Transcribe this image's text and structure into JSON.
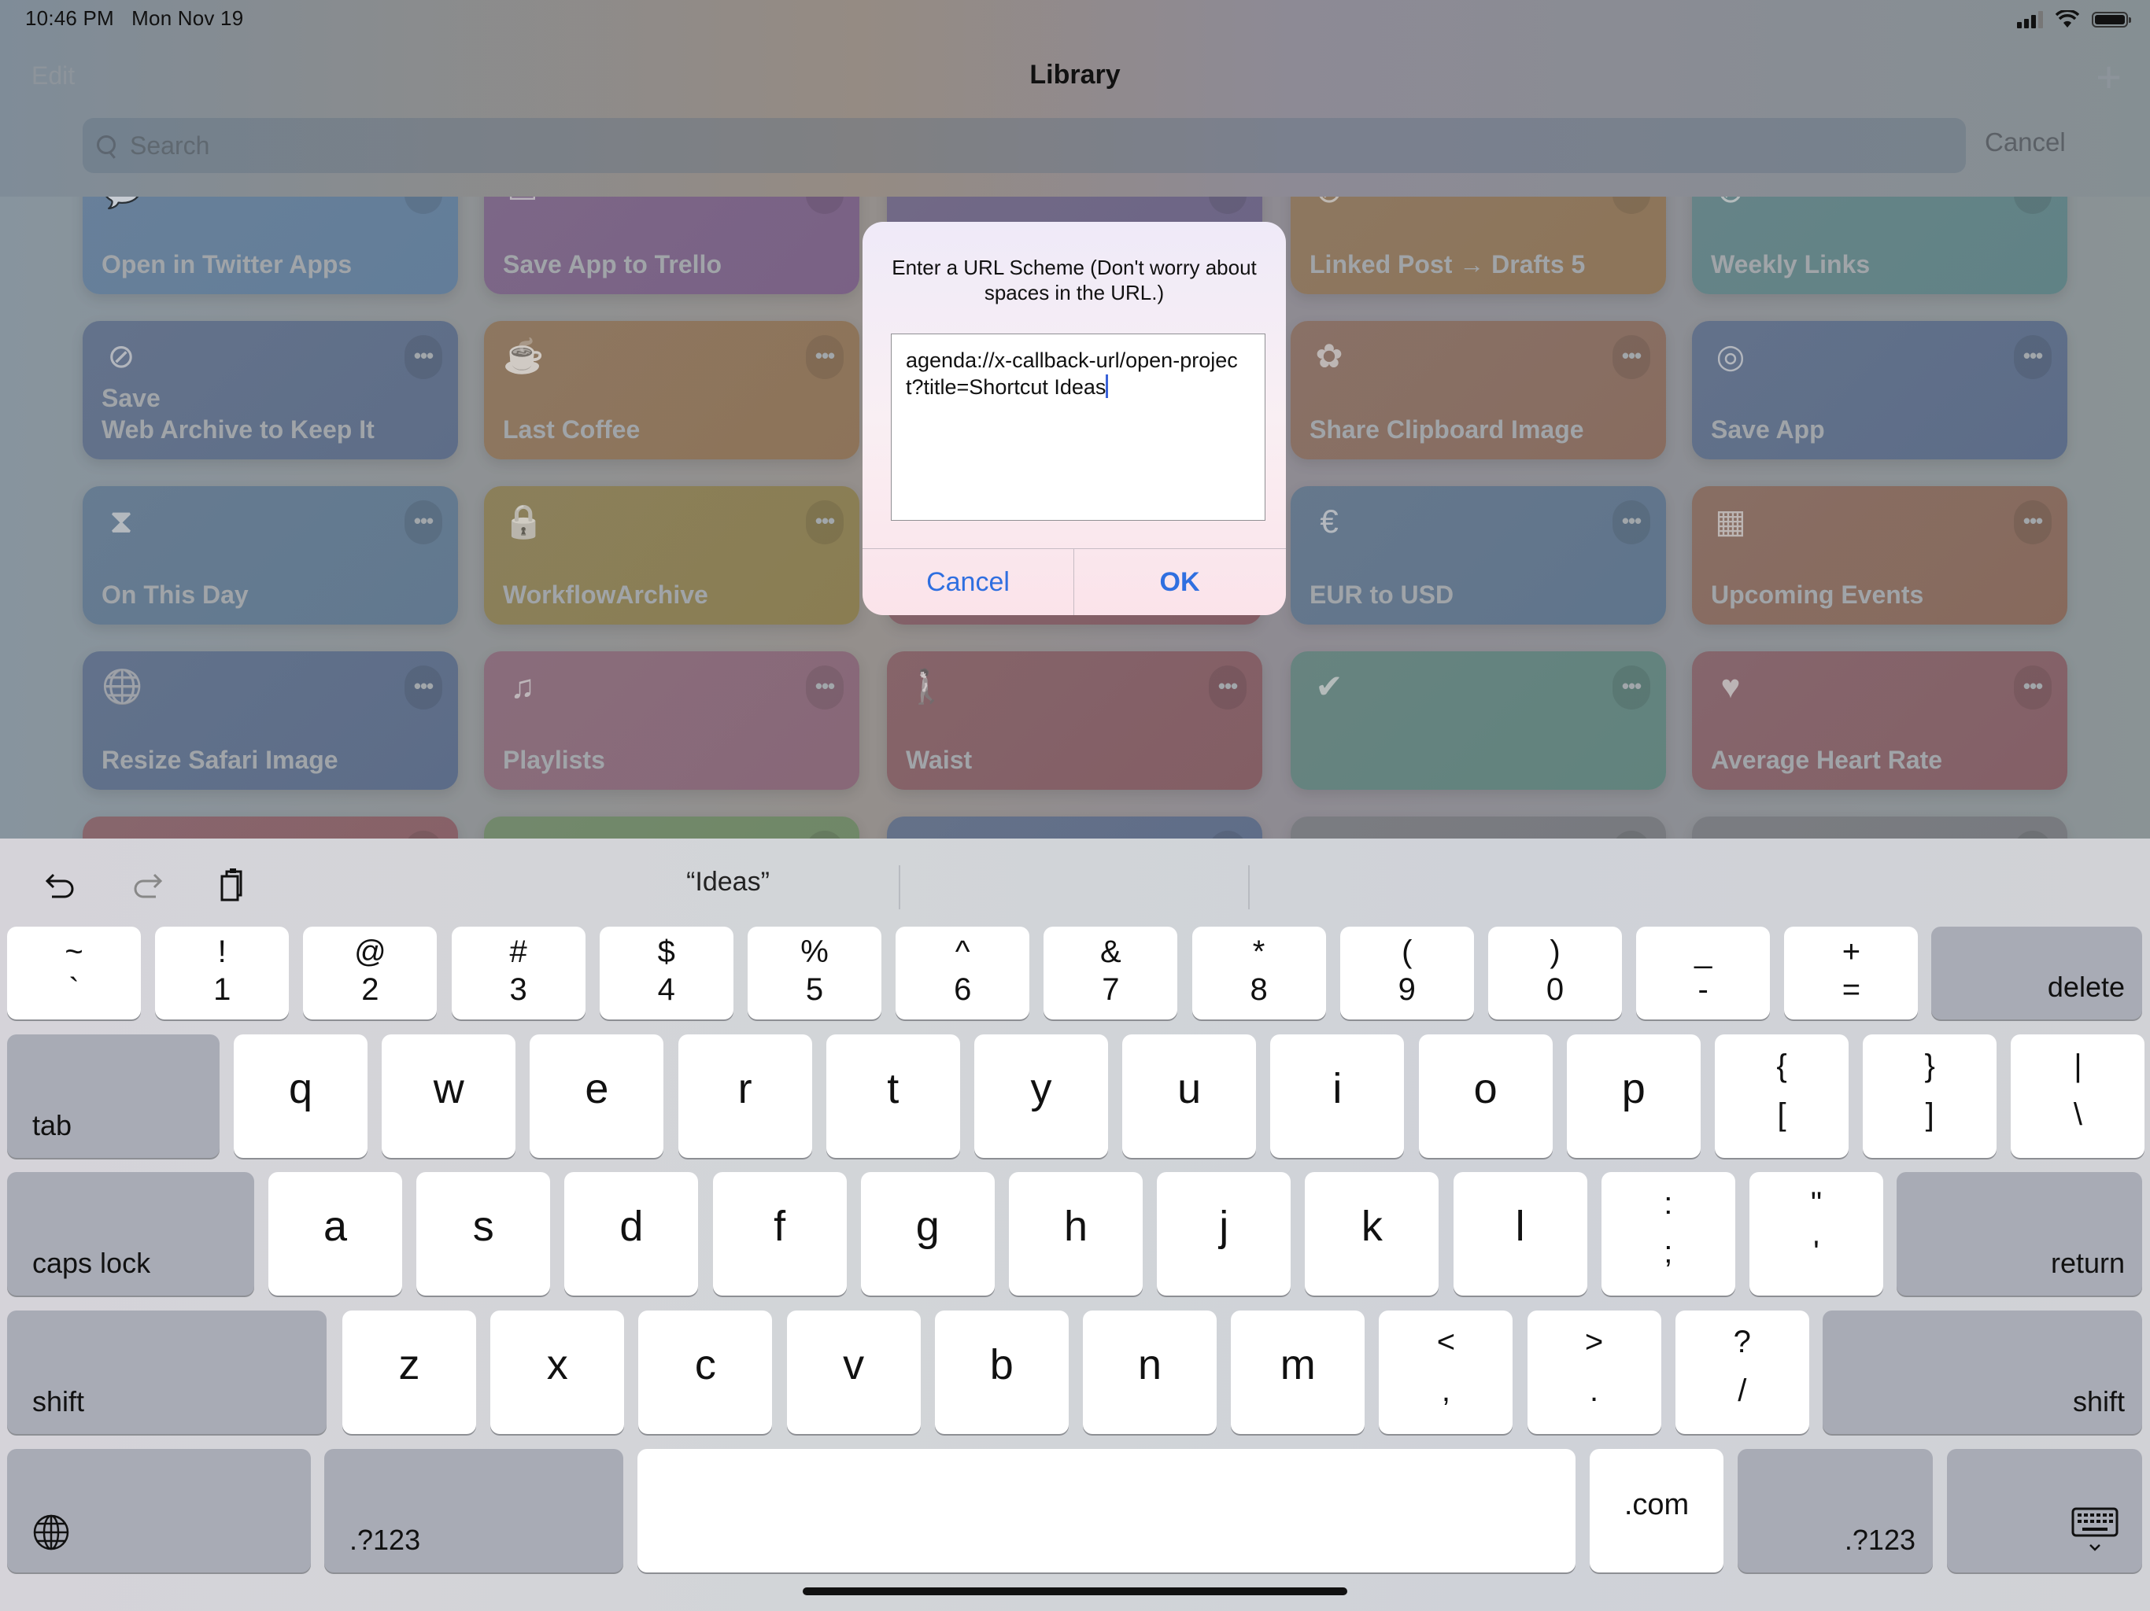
{
  "status_bar": {
    "time": "10:46 PM",
    "date": "Mon Nov 19",
    "icons": [
      "cellular-signal-icon",
      "wifi-icon",
      "battery-icon"
    ],
    "battery_level": 1.0
  },
  "nav": {
    "edit_label": "Edit",
    "title": "Library",
    "add_icon": "plus-icon"
  },
  "search": {
    "placeholder": "Search",
    "value": "",
    "cancel_label": "Cancel"
  },
  "shortcuts": [
    {
      "label": "Open in Twitter Apps",
      "icon": "speech-bubble-icon",
      "color": "#5e7ea0"
    },
    {
      "label": "Save App to Trello",
      "icon": "tray-icon",
      "color": "#7a5c88"
    },
    {
      "label": "",
      "icon": "",
      "color": "#6a6088"
    },
    {
      "label": "Linked Post → Drafts 5",
      "icon": "compass-icon",
      "color": "#927452"
    },
    {
      "label": "Weekly Links",
      "icon": "compass-icon",
      "color": "#5b8488"
    },
    {
      "label": "Save\nWeb Archive to Keep It",
      "icon": "compass-icon",
      "color": "#586b8c"
    },
    {
      "label": "Last Coffee",
      "icon": "coffee-cup-icon",
      "color": "#927252"
    },
    {
      "label": "",
      "icon": "",
      "color": "#8a5a66"
    },
    {
      "label": "Share Clipboard Image",
      "icon": "flower-icon",
      "color": "#8c6a5a"
    },
    {
      "label": "Save App",
      "icon": "target-icon",
      "color": "#566a8c"
    },
    {
      "label": "On This Day",
      "icon": "hourglass-icon",
      "color": "#5c7894"
    },
    {
      "label": "WorkflowArchive",
      "icon": "lock-icon",
      "color": "#8e7e4a"
    },
    {
      "label": "",
      "icon": "",
      "color": "#845660"
    },
    {
      "label": "EUR to USD",
      "icon": "euro-icon",
      "color": "#5a7490"
    },
    {
      "label": "Upcoming Events",
      "icon": "calendar-icon",
      "color": "#8a6656"
    },
    {
      "label": "Resize Safari Image",
      "icon": "globe-icon",
      "color": "#566a8c"
    },
    {
      "label": "Playlists",
      "icon": "music-note-icon",
      "color": "#8c6478"
    },
    {
      "label": "Waist",
      "icon": "person-icon",
      "color": "#865860"
    },
    {
      "label": "",
      "icon": "checkmark-circle-icon",
      "color": "#5c857e"
    },
    {
      "label": "Average Heart Rate",
      "icon": "heart-icon",
      "color": "#875a62"
    },
    {
      "label": "",
      "icon": "",
      "color": "#8a5a62"
    },
    {
      "label": "",
      "icon": "",
      "color": "#6c8a62"
    },
    {
      "label": "",
      "icon": "",
      "color": "#586a8c"
    },
    {
      "label": "",
      "icon": "",
      "color": "#777a80"
    },
    {
      "label": "",
      "icon": "",
      "color": "#777a80"
    }
  ],
  "dialog": {
    "message": "Enter a URL Scheme (Don't worry about spaces in the URL.)",
    "text_value": "agenda://x-callback-url/open-project?title=Shortcut Ideas",
    "cancel_label": "Cancel",
    "ok_label": "OK"
  },
  "keyboard": {
    "toolbar": [
      "undo-icon",
      "redo-icon",
      "paste-icon"
    ],
    "suggestions": [
      "“Ideas”",
      "",
      ""
    ],
    "row1": [
      {
        "top": "~",
        "bot": "`"
      },
      {
        "top": "!",
        "bot": "1"
      },
      {
        "top": "@",
        "bot": "2"
      },
      {
        "top": "#",
        "bot": "3"
      },
      {
        "top": "$",
        "bot": "4"
      },
      {
        "top": "%",
        "bot": "5"
      },
      {
        "top": "^",
        "bot": "6"
      },
      {
        "top": "&",
        "bot": "7"
      },
      {
        "top": "*",
        "bot": "8"
      },
      {
        "top": "(",
        "bot": "9"
      },
      {
        "top": ")",
        "bot": "0"
      },
      {
        "top": "_",
        "bot": "-"
      },
      {
        "top": "+",
        "bot": "="
      }
    ],
    "delete_label": "delete",
    "tab_label": "tab",
    "row2": [
      "q",
      "w",
      "e",
      "r",
      "t",
      "y",
      "u",
      "i",
      "o",
      "p"
    ],
    "row2_sym": [
      {
        "top": "{",
        "bot": "["
      },
      {
        "top": "}",
        "bot": "]"
      },
      {
        "top": "|",
        "bot": "\\"
      }
    ],
    "caps_label": "caps lock",
    "row3": [
      "a",
      "s",
      "d",
      "f",
      "g",
      "h",
      "j",
      "k",
      "l"
    ],
    "row3_sym": [
      {
        "top": ":",
        "bot": ";"
      },
      {
        "top": "\"",
        "bot": "'"
      }
    ],
    "return_label": "return",
    "shift_label": "shift",
    "row4": [
      "z",
      "x",
      "c",
      "v",
      "b",
      "n",
      "m"
    ],
    "row4_sym": [
      {
        "top": "<",
        "bot": ","
      },
      {
        "top": ">",
        "bot": "."
      },
      {
        "top": "?",
        "bot": "/"
      }
    ],
    "globe_icon": "globe-icon",
    "numbers_label": ".?123",
    "space_label": "",
    "dotcom_label": ".com",
    "dismiss_icon": "keyboard-dismiss-icon"
  }
}
